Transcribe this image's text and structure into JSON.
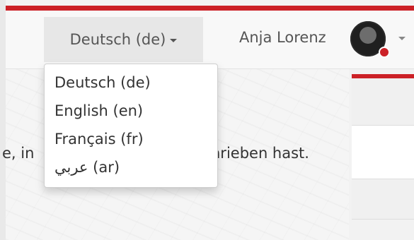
{
  "navbar": {
    "language_toggle": "Deutsch (de)",
    "user_name": "Anja Lorenz"
  },
  "language_menu": [
    "Deutsch (de)",
    "English (en)",
    "Français (fr)",
    "عربي (ar)"
  ],
  "content": {
    "text_left": "e, in",
    "text_right": "hrieben hast."
  },
  "colors": {
    "accent": "#cc2127",
    "navbar": "#f8f8f8",
    "toggle_active": "#e7e7e7"
  },
  "icons": [
    "caret-down-icon",
    "avatar-image",
    "notification-badge-icon"
  ]
}
